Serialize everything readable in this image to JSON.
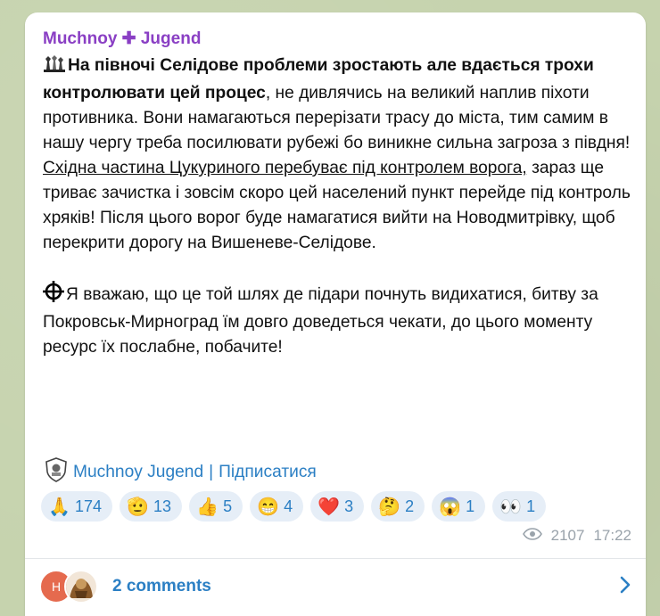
{
  "post": {
    "author": "Muchnoy ✚ Jugend",
    "paragraph1": {
      "bold": "На півночі Селідове проблеми зростають але вдається трохи контролювати цей процес",
      "plain1": ", не дивлячись на великий наплив піхоти противника. Вони намагаються перерізати трасу до міста, тим самим в нашу чергу треба посилювати рубежі бо виникне сильна загроза з півдня! ",
      "underlined": "Східна частина Цукуриного перебуває під контролем ворога,",
      "plain2": " зараз ще триває зачистка і зовсім скоро цей населений пункт перейде під контроль хряків! Після цього ворог буде намагатися вийти на Новодмитрівку, щоб перекрити дорогу на Вишеневе-Селідове."
    },
    "paragraph2": "Я вважаю, що це той шлях де підари почнуть видихатися, битву за Покровськ-Мирноград їм довго доведеться чекати, до цього моменту ресурс їх послабне, побачите!",
    "signature": {
      "channel": "Muchnoy Jugend",
      "separator": "|",
      "subscribe": "Підписатися"
    },
    "reactions": [
      {
        "emoji": "🙏",
        "count": "174"
      },
      {
        "emoji": "🫡",
        "count": "13"
      },
      {
        "emoji": "👍",
        "count": "5"
      },
      {
        "emoji": "😁",
        "count": "4"
      },
      {
        "emoji": "❤️",
        "count": "3"
      },
      {
        "emoji": "🤔",
        "count": "2"
      },
      {
        "emoji": "😱",
        "count": "1"
      },
      {
        "emoji": "👀",
        "count": "1"
      }
    ],
    "views": "2107",
    "time": "17:22",
    "comments": {
      "avatar_letter": "H",
      "label": "2 comments"
    }
  },
  "colors": {
    "author": "#8a3fc4",
    "link": "#2b7fc4",
    "reaction_bg": "#e6eef7",
    "avatar": "#e56a4e",
    "background": "#c6d3ae"
  },
  "icons": [
    "chess-pieces-icon",
    "crosshair-icon",
    "shield-logo-icon",
    "eye-icon",
    "chevron-right-icon"
  ]
}
